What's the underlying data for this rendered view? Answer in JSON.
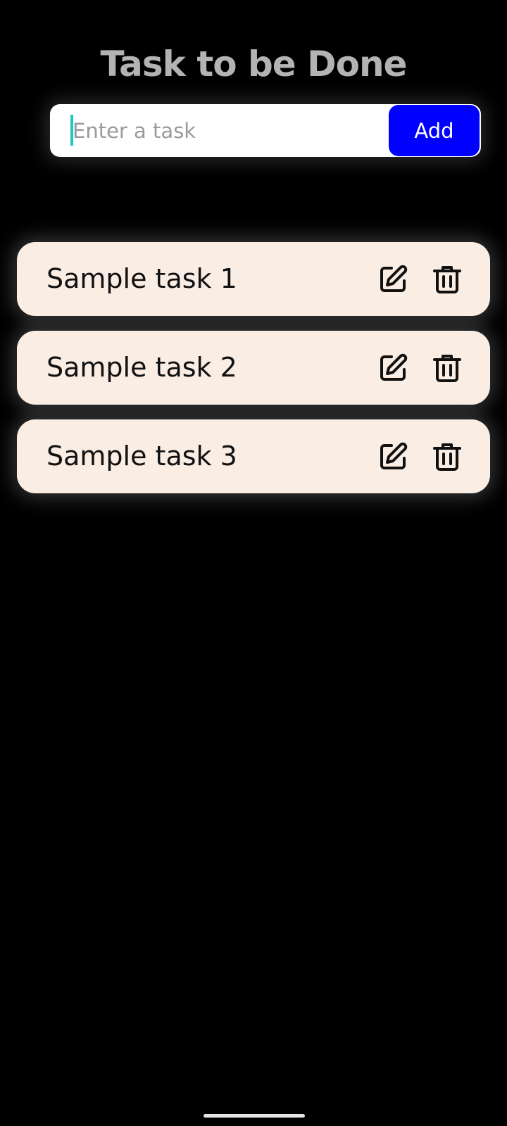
{
  "header": {
    "title": "Task to be Done"
  },
  "task_entry": {
    "value": "",
    "placeholder": "Enter a task",
    "add_label": "Add"
  },
  "tasks": [
    {
      "label": "Sample task 1"
    },
    {
      "label": "Sample task 2"
    },
    {
      "label": "Sample task 3"
    }
  ],
  "icons": {
    "edit": "edit-icon",
    "delete": "trash-icon"
  },
  "colors": {
    "background": "#000000",
    "title": "#b3b3b3",
    "add_button": "#0000ff",
    "task_card": "#f9ede4",
    "caret": "#1ec7c2"
  }
}
